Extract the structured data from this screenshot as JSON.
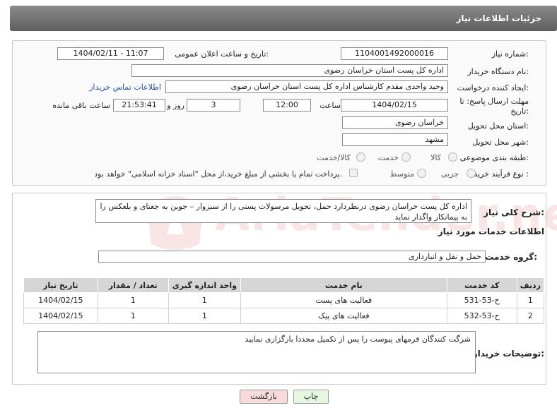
{
  "header": {
    "title": "جزئیات اطلاعات نیاز"
  },
  "form": {
    "need_number_label": "شماره نیاز:",
    "need_number": "1104001492000016",
    "announce_label": "تاریخ و ساعت اعلان عمومی:",
    "announce_value": "1404/02/11 - 11:07",
    "buyer_org_label": "نام دستگاه خریدار:",
    "buyer_org": "اداره کل پست استان خراسان رضوی",
    "creator_label": "ایجاد کننده درخواست:",
    "creator": "وحید واحدی مقدم کارشناس اداره کل پست استان خراسان رضوی",
    "contact_link": "اطلاعات تماس خریدار",
    "deadline_label_1": "مهلت ارسال پاسخ: تا",
    "deadline_label_2": "تاریخ:",
    "deadline_date": "1404/02/15",
    "time_label": "ساعت",
    "deadline_time": "12:00",
    "days_value": "3",
    "days_label": "روز و",
    "remaining_time": "21:53:41",
    "remaining_label": "ساعت باقی مانده",
    "province_label": "استان محل تحویل:",
    "province": "خراسان رضوی",
    "city_label": "شهر محل تحویل:",
    "city": "مشهد",
    "category_label": "طبقه بندی موضوعی:",
    "category_options": [
      "کالا",
      "خدمت",
      "کالا/خدمت"
    ],
    "process_label": "نوع فرآیند خرید :",
    "process_options": [
      "جزیی",
      "متوسط"
    ],
    "payment_note": "پرداخت تمام یا بخشی از مبلغ خرید،از محل \"اسناد خزانه اسلامی\" خواهد بود."
  },
  "description": {
    "label": "شرح کلی نیاز:",
    "text": "اداره کل پست خراسان رضوی درنظردارد حمل، تحویل مرسولات پستی را از سبزوار – جوین به جغتای و بلعکس را به پیمانکار واگذار نماید"
  },
  "services": {
    "section_title": "اطلاعات خدمات مورد نیاز",
    "group_label": "گروه خدمت:",
    "group_value": "حمل و نقل و انبارداری",
    "columns": [
      "ردیف",
      "کد خدمت",
      "نام خدمت",
      "واحد اندازه گیری",
      "تعداد / مقدار",
      "تاریخ نیاز"
    ],
    "rows": [
      [
        "1",
        "ح-53-531",
        "فعالیت های پست",
        "1",
        "1",
        "1404/02/15"
      ],
      [
        "2",
        "ح-53-532",
        "فعالیت های پیک",
        "1",
        "1",
        "1404/02/15"
      ]
    ]
  },
  "buyer_notes": {
    "label": "توضیحات خریدار:",
    "text": "شرگت کنندگان فرمهای پیوست را پس از تکمیل مجددا بارگزاری نمایید"
  },
  "buttons": {
    "print": "چاپ",
    "back": "بازگشت"
  },
  "watermark": {
    "text": "AriaTender.neT"
  },
  "colors": {
    "header": "#6e6e6e",
    "link": "#1a4fa8",
    "back_button": "#f7dada",
    "print_button": "#e6f7e0",
    "watermark": "#d33030"
  }
}
